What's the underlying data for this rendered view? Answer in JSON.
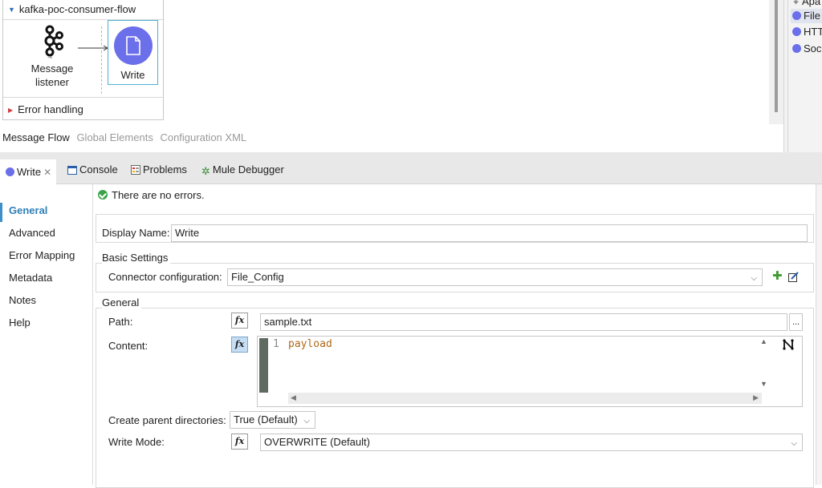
{
  "canvas": {
    "flow_title": "kafka-poc-consumer-flow",
    "listener_label_1": "Message",
    "listener_label_2": "listener",
    "write_label": "Write",
    "error_handling": "Error handling",
    "view_tabs": [
      "Message Flow",
      "Global Elements",
      "Configuration XML"
    ],
    "palette": [
      "Apa",
      "File",
      "HTT",
      "Sock"
    ]
  },
  "tabs": {
    "write": "Write",
    "console": "Console",
    "problems": "Problems",
    "debugger": "Mule Debugger"
  },
  "nav": [
    "General",
    "Advanced",
    "Error Mapping",
    "Metadata",
    "Notes",
    "Help"
  ],
  "status": "There are no errors.",
  "form": {
    "display_name_label": "Display Name:",
    "display_name_value": "Write",
    "basic_settings_title": "Basic Settings",
    "connector_label": "Connector configuration:",
    "connector_value": "File_Config",
    "general_title": "General",
    "path_label": "Path:",
    "path_value": "sample.txt",
    "path_browse": "...",
    "content_label": "Content:",
    "content_line_no": "1",
    "content_code": "payload",
    "create_parent_label": "Create parent directories:",
    "create_parent_value": "True (Default)",
    "write_mode_label": "Write Mode:",
    "write_mode_value": "OVERWRITE (Default)",
    "fx_label": "fx"
  },
  "colors": {
    "accent": "#6b6fea",
    "nav_active": "#2f7fb5",
    "code": "#b06a1c"
  }
}
